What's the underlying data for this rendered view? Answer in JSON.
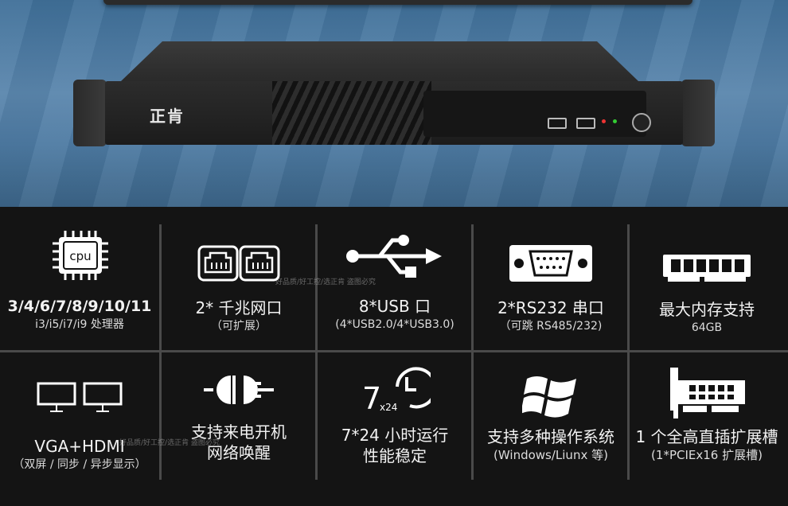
{
  "hero": {
    "brand_logo": "正肯"
  },
  "features": [
    {
      "title": "3/4/6/7/8/9/10/11",
      "subtitle": "i3/i5/i7/i9 处理器",
      "icon": "cpu-icon",
      "icon_text": "cpu"
    },
    {
      "title": "2* 千兆网口",
      "subtitle": "（可扩展）",
      "icon": "ethernet-ports-icon"
    },
    {
      "title": "8*USB 口",
      "subtitle": "(4*USB2.0/4*USB3.0)",
      "icon": "usb-icon"
    },
    {
      "title": "2*RS232 串口",
      "subtitle": "（可跳 RS485/232)",
      "icon": "serial-port-icon"
    },
    {
      "title": "最大内存支持",
      "subtitle": "64GB",
      "icon": "ram-icon"
    },
    {
      "title": "VGA+HDMI",
      "subtitle": "（双屏 / 同步 / 异步显示）",
      "icon": "dual-monitor-icon"
    },
    {
      "title": "支持来电开机",
      "subtitle": "网络唤醒",
      "icon": "power-plug-icon"
    },
    {
      "title": "7*24 小时运行",
      "subtitle": "性能稳定",
      "icon": "clock-24-icon",
      "icon_text": "7",
      "icon_small": "x24"
    },
    {
      "title": "支持多种操作系统",
      "subtitle": "(Windows/Liunx 等)",
      "icon": "windows-logo-icon"
    },
    {
      "title": "1 个全高直插扩展槽",
      "subtitle": "(1*PCIEx16 扩展槽)",
      "icon": "pcie-card-icon"
    }
  ],
  "watermark": "好品质/好工控/选正肯 \n 盗图必究"
}
